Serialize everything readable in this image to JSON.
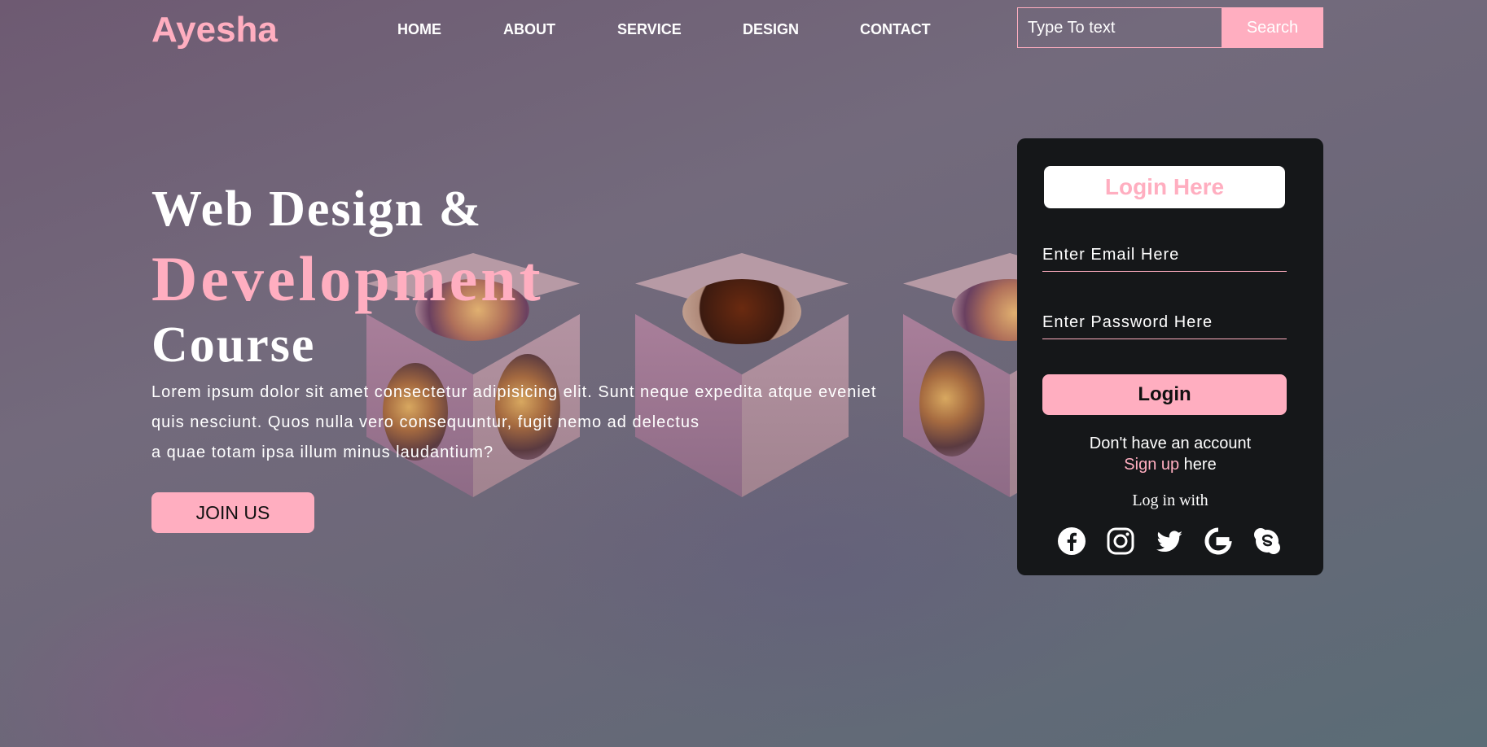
{
  "brand": {
    "name": "Ayesha",
    "color": "#ffaec0"
  },
  "nav": [
    {
      "label": "HOME"
    },
    {
      "label": "ABOUT"
    },
    {
      "label": "SERVICE"
    },
    {
      "label": "DESIGN"
    },
    {
      "label": "CONTACT"
    }
  ],
  "search": {
    "placeholder": "Type To text",
    "button_label": "Search"
  },
  "hero": {
    "line1": "Web Design &",
    "line2": "Development",
    "line3": "Course",
    "paragraph": [
      "Lorem ipsum dolor sit amet consectetur adipisicing elit. Sunt neque expedita atque eveniet",
      "quis nesciunt. Quos nulla vero consequuntur, fugit nemo ad delectus",
      "a quae totam ipsa illum minus laudantium?"
    ],
    "join_label": "JOIN US"
  },
  "login": {
    "title": "Login Here",
    "email_placeholder": "Enter Email Here",
    "password_placeholder": "Enter Password Here",
    "button_label": "Login",
    "no_account": "Don't have an account",
    "signup_link": "Sign up",
    "signup_suffix": " here",
    "login_with": "Log in with",
    "socials": [
      "facebook-icon",
      "instagram-icon",
      "twitter-icon",
      "google-icon",
      "skype-icon"
    ]
  },
  "colors": {
    "accent": "#ffaec0",
    "card": "#151719",
    "text": "#ffffff"
  }
}
